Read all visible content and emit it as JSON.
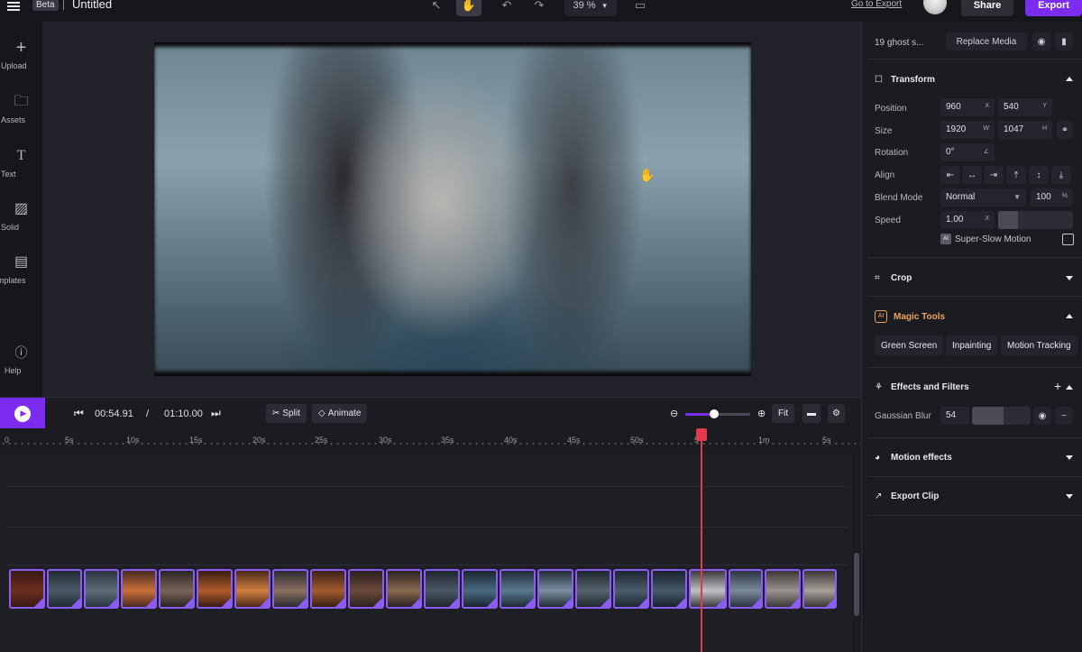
{
  "topbar": {
    "beta": "Beta",
    "title": "Untitled",
    "zoom": "39 %",
    "goto_export": "Go to Export",
    "share": "Share",
    "export": "Export"
  },
  "sidebar": {
    "items": [
      {
        "label": "Upload",
        "icon": "plus-icon"
      },
      {
        "label": "Assets",
        "icon": "folder-icon"
      },
      {
        "label": "Text",
        "icon": "text-icon"
      },
      {
        "label": "Solid",
        "icon": "solid-icon"
      },
      {
        "label": "emplates",
        "icon": "templates-icon"
      },
      {
        "label": "Help",
        "icon": "help-icon"
      }
    ]
  },
  "playback": {
    "current_time": "00:54.91",
    "separator": "/",
    "total_time": "01:10.00",
    "split": "Split",
    "animate": "Animate",
    "fit": "Fit",
    "zoom_level": 0.45
  },
  "timeline": {
    "ticks": [
      "0",
      "5s",
      "10s",
      "15s",
      "20s",
      "25s",
      "30s",
      "35s",
      "40s",
      "45s",
      "50s",
      "5",
      "1m",
      "5s"
    ]
  },
  "panel": {
    "media_name": "19 ghost s...",
    "replace_media": "Replace Media",
    "transform": {
      "title": "Transform",
      "position_label": "Position",
      "position_x": "960",
      "position_y": "540",
      "size_label": "Size",
      "size_w": "1920",
      "size_h": "1047",
      "rotation_label": "Rotation",
      "rotation": "0°",
      "align_label": "Align",
      "blend_label": "Blend Mode",
      "blend_mode": "Normal",
      "opacity": "100",
      "speed_label": "Speed",
      "speed": "1.00",
      "super_slow": "Super-Slow Motion",
      "units": {
        "x": "X",
        "y": "Y",
        "w": "W",
        "h": "H",
        "pct": "%"
      }
    },
    "crop": {
      "title": "Crop"
    },
    "magic": {
      "badge": "AI",
      "title": "Magic Tools",
      "green_screen": "Green Screen",
      "inpainting": "Inpainting",
      "motion_tracking": "Motion Tracking"
    },
    "effects": {
      "title": "Effects and Filters",
      "gaussian_label": "Gaussian Blur",
      "gaussian_value": "54"
    },
    "motion_effects": {
      "title": "Motion effects"
    },
    "export_clip": {
      "title": "Export Clip"
    }
  },
  "colors": {
    "accent": "#7b2cf0",
    "playhead": "#e23c4c",
    "clip_border": "#8b5cf6"
  }
}
